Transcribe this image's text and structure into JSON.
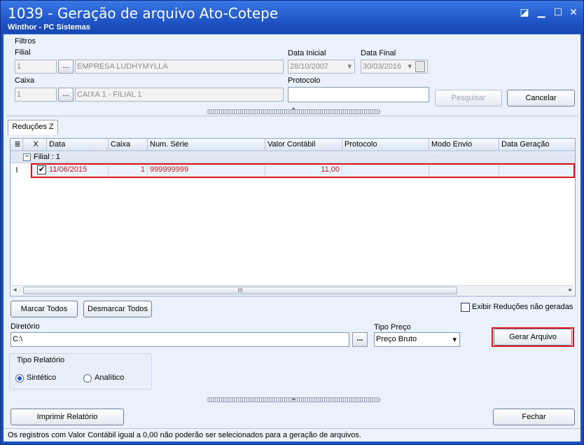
{
  "window": {
    "title": "1039 - Geração de arquivo Ato-Cotepe",
    "subtitle": "Winthor - PC Sistemas",
    "minimize_icon": "restore-icon",
    "controls": [
      "☐",
      "—",
      "□",
      "✕"
    ]
  },
  "filters": {
    "section_label": "Filtros",
    "filial_label": "Filial",
    "filial_code": "1",
    "filial_name": "EMPRESA LUDHYMYLLA",
    "caixa_label": "Caixa",
    "caixa_code": "1",
    "caixa_name": "CAIXA 1 - FILIAL 1",
    "lookup_label": "...",
    "data_inicial_label": "Data Inicial",
    "data_inicial": "28/10/2007",
    "data_final_label": "Data Final",
    "data_final": "30/03/2016",
    "protocolo_label": "Protocolo",
    "protocolo_value": "",
    "pesquisar_label": "Pesquisar",
    "cancelar_label": "Cancelar"
  },
  "tabs": [
    {
      "label": "Reduções Z"
    }
  ],
  "grid": {
    "columns": [
      "X",
      "Data",
      "Caixa",
      "Num. Série",
      "Valor Contábil",
      "Protocolo",
      "Modo Envio",
      "Data Geração"
    ],
    "group_label": "Filial : 1",
    "row_indicator": "I",
    "rows": [
      {
        "checked": true,
        "data": "11/06/2015",
        "caixa": "1",
        "num_serie": "999999999",
        "valor_contabil": "11,00",
        "protocolo": "",
        "modo_envio": "",
        "data_geracao": ""
      }
    ],
    "scroll_grip": "III"
  },
  "actions": {
    "marcar_todos": "Marcar Todos",
    "desmarcar_todos": "Desmarcar Todos",
    "exibir_reducoes": "Exibir Reduções não geradas",
    "diretorio_label": "Diretório",
    "diretorio_value": "C:\\",
    "tipo_preco_label": "Tipo Preço",
    "tipo_preco_value": "Preço Bruto",
    "gerar_arquivo": "Gerar Arquivo"
  },
  "relatorio": {
    "label": "Tipo Relatório",
    "options": [
      "Sintético",
      "Analítico"
    ],
    "selected": "Sintético"
  },
  "footer": {
    "imprimir": "Imprimir Relatório",
    "fechar": "Fechar",
    "status": "Os registros com Valor Contábil igual a 0,00 não poderão ser selecionados para a geração de arquivos."
  },
  "colors": {
    "accent": "#1b4fbd",
    "highlight_outline": "#e0151b",
    "row_text": "#d4141a"
  }
}
